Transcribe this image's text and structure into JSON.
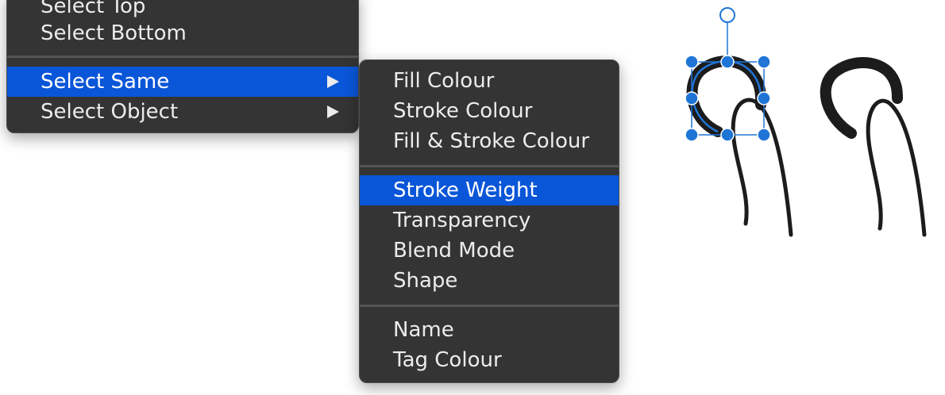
{
  "main_menu": {
    "items": [
      {
        "label": "Select Top"
      },
      {
        "label": "Select Bottom"
      },
      {
        "label": "Select Same",
        "highlighted": true,
        "has_submenu": true
      },
      {
        "label": "Select Object",
        "has_submenu": true
      }
    ]
  },
  "select_same_submenu": {
    "groups": [
      [
        "Fill Colour",
        "Stroke Colour",
        "Fill & Stroke Colour"
      ],
      [
        "Stroke Weight",
        "Transparency",
        "Blend Mode",
        "Shape"
      ],
      [
        "Name",
        "Tag Colour"
      ]
    ],
    "highlighted_item": "Stroke Weight"
  },
  "colors": {
    "menu_bg": "#343434",
    "highlight": "#0a56d8",
    "selection_handle": "#1f75d6"
  },
  "canvas": {
    "objects": [
      {
        "name": "selected-thick-arc-stroke",
        "selected": true
      },
      {
        "name": "thin-curve-stroke-left"
      },
      {
        "name": "thick-arc-stroke"
      },
      {
        "name": "thin-curve-stroke-right"
      }
    ]
  }
}
